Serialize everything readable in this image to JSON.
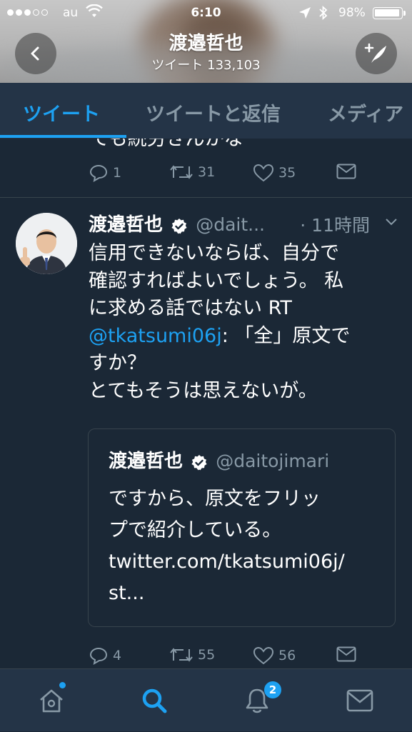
{
  "status_bar": {
    "carrier": "au",
    "time": "6:10",
    "battery_percent": "98%"
  },
  "header": {
    "name": "渡邉哲也",
    "tweet_count": "ツイート 133,103"
  },
  "tabs": [
    {
      "label": "ツイート",
      "active": true
    },
    {
      "label": "ツイートと返信",
      "active": false
    },
    {
      "label": "メディア",
      "active": false
    }
  ],
  "prev_tweet": {
    "cut_text": "ても続労きんかな",
    "replies": "1",
    "retweets": "31",
    "likes": "35"
  },
  "tweet": {
    "author": "渡邉哲也",
    "handle": "@dait...",
    "time_ago": "· 11時間",
    "lines": [
      "信用できないならば、自分で",
      "確認すればよいでしょう。 私",
      "に求める話ではない RT"
    ],
    "mention": "@tkatsumi06j",
    "mention_rest": ": 「全」原文で",
    "lines_after": [
      "すか？",
      "とてもそうは思えないが。"
    ],
    "quote": {
      "author": "渡邉哲也",
      "handle": "@daitojimari",
      "lines": [
        "ですから、原文をフリッ",
        "プで紹介している。",
        "twitter.com/tkatsumi06j/",
        "st..."
      ]
    },
    "replies": "4",
    "retweets": "55",
    "likes": "56"
  },
  "bottom_nav": {
    "notifications_badge": "2"
  },
  "colors": {
    "accent": "#1da1f2",
    "background": "#1b2836",
    "bar": "#243447",
    "muted": "#8899a6"
  }
}
